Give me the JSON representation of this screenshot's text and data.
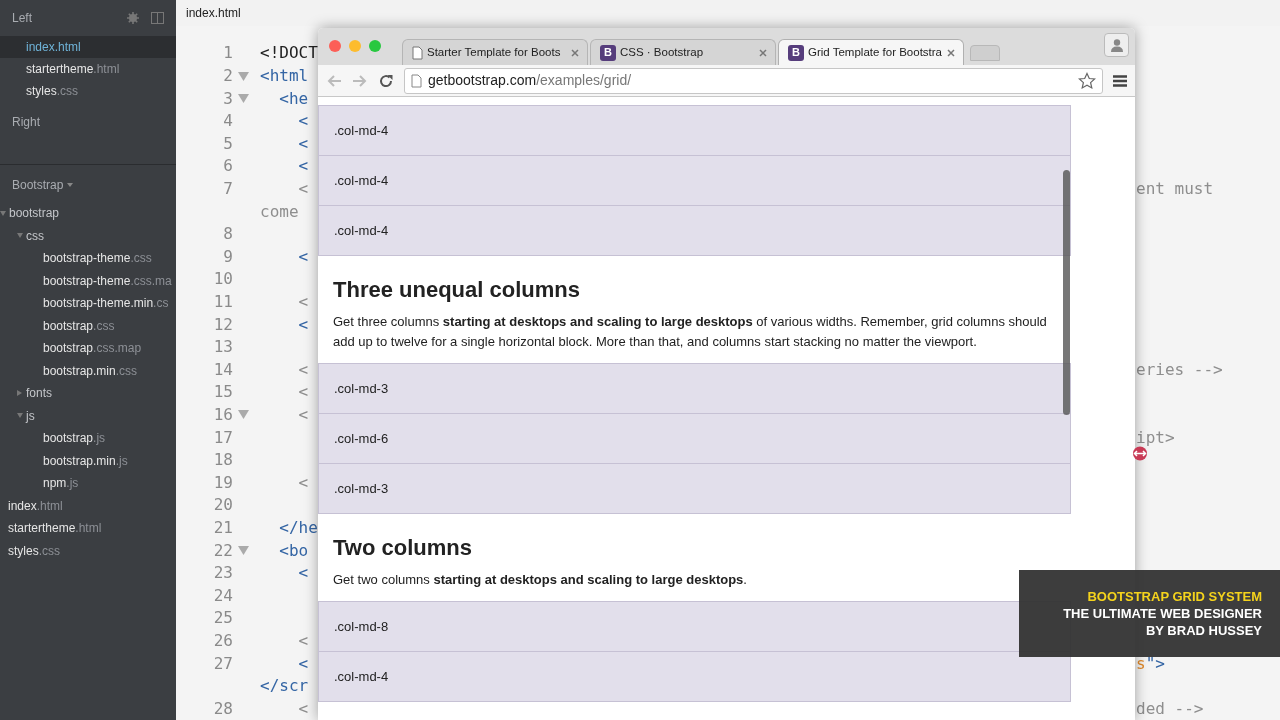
{
  "sidebar": {
    "working_files": {
      "title": "Left",
      "items": [
        {
          "name": "index",
          "ext": ".html",
          "selected": true
        },
        {
          "name": "startertheme",
          "ext": ".html",
          "selected": false
        },
        {
          "name": "styles",
          "ext": ".css",
          "selected": false
        }
      ]
    },
    "right_pane": {
      "title": "Right"
    },
    "project": {
      "title": "Bootstrap",
      "tree": [
        {
          "kind": "folder",
          "name": "bootstrap",
          "expanded": true,
          "children": [
            {
              "kind": "folder",
              "name": "css",
              "expanded": true,
              "children": [
                {
                  "kind": "file",
                  "name": "bootstrap-theme",
                  "ext": ".css"
                },
                {
                  "kind": "file",
                  "name": "bootstrap-theme",
                  "ext": ".css.ma"
                },
                {
                  "kind": "file",
                  "name": "bootstrap-theme.min",
                  "ext": ".cs"
                },
                {
                  "kind": "file",
                  "name": "bootstrap",
                  "ext": ".css"
                },
                {
                  "kind": "file",
                  "name": "bootstrap",
                  "ext": ".css.map"
                },
                {
                  "kind": "file",
                  "name": "bootstrap.min",
                  "ext": ".css"
                }
              ]
            },
            {
              "kind": "folder",
              "name": "fonts",
              "expanded": false
            },
            {
              "kind": "folder",
              "name": "js",
              "expanded": true,
              "children": [
                {
                  "kind": "file",
                  "name": "bootstrap",
                  "ext": ".js"
                },
                {
                  "kind": "file",
                  "name": "bootstrap.min",
                  "ext": ".js"
                },
                {
                  "kind": "file",
                  "name": "npm",
                  "ext": ".js"
                }
              ]
            }
          ]
        },
        {
          "kind": "file",
          "name": "index",
          "ext": ".html"
        },
        {
          "kind": "file",
          "name": "startertheme",
          "ext": ".html"
        },
        {
          "kind": "file",
          "name": "styles",
          "ext": ".css"
        }
      ]
    }
  },
  "editor": {
    "tab": "index.html",
    "lines": [
      {
        "number": "1",
        "fold": false,
        "left": {
          "text": "<!DOCT",
          "kind": "plain"
        }
      },
      {
        "number": "2",
        "fold": true,
        "left": {
          "text": "<html",
          "kind": "tag"
        }
      },
      {
        "number": "3",
        "fold": true,
        "left": {
          "text": "  <he",
          "kind": "tag"
        }
      },
      {
        "number": "4",
        "fold": false,
        "left": {
          "text": "    <",
          "kind": "tag"
        }
      },
      {
        "number": "5",
        "fold": false,
        "left": {
          "text": "    <",
          "kind": "tag"
        }
      },
      {
        "number": "6",
        "fold": false,
        "left": {
          "text": "    <",
          "kind": "tag"
        }
      },
      {
        "number": "7",
        "fold": false,
        "left": {
          "text": "    <",
          "kind": "comment"
        },
        "right": [
          {
            "text": "ent must",
            "kind": "comment"
          }
        ]
      },
      {
        "fold": false,
        "left": {
          "text": "come",
          "kind": "comment"
        }
      },
      {
        "number": "8",
        "fold": false
      },
      {
        "number": "9",
        "fold": false,
        "left": {
          "text": "    <",
          "kind": "tag"
        }
      },
      {
        "number": "10",
        "fold": false
      },
      {
        "number": "11",
        "fold": false,
        "left": {
          "text": "    <",
          "kind": "comment"
        }
      },
      {
        "number": "12",
        "fold": false,
        "left": {
          "text": "    <",
          "kind": "tag"
        }
      },
      {
        "number": "13",
        "fold": false
      },
      {
        "number": "14",
        "fold": false,
        "left": {
          "text": "    <",
          "kind": "comment"
        },
        "right": [
          {
            "text": "eries -->",
            "kind": "comment"
          }
        ]
      },
      {
        "number": "15",
        "fold": false,
        "left": {
          "text": "    <",
          "kind": "comment"
        }
      },
      {
        "number": "16",
        "fold": true,
        "left": {
          "text": "    <",
          "kind": "comment"
        }
      },
      {
        "number": "17",
        "fold": false,
        "right": [
          {
            "text": "ipt>",
            "kind": "comment"
          }
        ]
      },
      {
        "number": "18",
        "fold": false
      },
      {
        "number": "19",
        "fold": false,
        "left": {
          "text": "    <",
          "kind": "comment"
        }
      },
      {
        "number": "20",
        "fold": false
      },
      {
        "number": "21",
        "fold": false,
        "left": {
          "text": "  </he",
          "kind": "tag"
        }
      },
      {
        "number": "22",
        "fold": true,
        "left": {
          "text": "  <bo",
          "kind": "tag"
        }
      },
      {
        "number": "23",
        "fold": false,
        "left": {
          "text": "    <",
          "kind": "tag"
        }
      },
      {
        "number": "24",
        "fold": false
      },
      {
        "number": "25",
        "fold": false
      },
      {
        "number": "26",
        "fold": false,
        "left": {
          "text": "    <",
          "kind": "comment"
        }
      },
      {
        "number": "27",
        "fold": false,
        "left": {
          "text": "    <",
          "kind": "tag"
        },
        "right": [
          {
            "text": "s",
            "kind": "string"
          },
          {
            "text": "\">",
            "kind": "tag"
          }
        ]
      },
      {
        "fold": false,
        "left": {
          "text": "</scr",
          "kind": "tag"
        }
      },
      {
        "number": "28",
        "fold": false,
        "left": {
          "text": "    <",
          "kind": "comment"
        },
        "right": [
          {
            "text": "ded -->",
            "kind": "comment"
          }
        ]
      }
    ]
  },
  "browser": {
    "tabs": [
      {
        "title": "Starter Template for Boots",
        "selected": false
      },
      {
        "title": "CSS · Bootstrap",
        "favicon": "B",
        "selected": false
      },
      {
        "title": "Grid Template for Bootstra",
        "favicon": "B",
        "selected": true
      }
    ],
    "url": {
      "host": "getbootstrap.com",
      "path": "/examples/grid/"
    },
    "content": [
      {
        "kind": "column",
        "text": ".col-md-4"
      },
      {
        "kind": "column",
        "text": ".col-md-4"
      },
      {
        "kind": "column",
        "text": ".col-md-4"
      },
      {
        "kind": "heading",
        "text": "Three unequal columns"
      },
      {
        "kind": "paragraph",
        "text": "Get three columns **starting at desktops and scaling to large desktops** of various widths. Remember, grid columns should add up to twelve for a single horizontal block. More than that, and columns start stacking no matter the viewport."
      },
      {
        "kind": "column",
        "text": ".col-md-3"
      },
      {
        "kind": "column",
        "text": ".col-md-6"
      },
      {
        "kind": "column",
        "text": ".col-md-3"
      },
      {
        "kind": "heading",
        "text": "Two columns"
      },
      {
        "kind": "paragraph",
        "text": "Get two columns **starting at desktops and scaling to large desktops**."
      },
      {
        "kind": "column",
        "text": ".col-md-8"
      },
      {
        "kind": "column",
        "text": ".col-md-4"
      }
    ]
  },
  "overlay": {
    "lines": [
      {
        "text": "BOOTSTRAP GRID SYSTEM",
        "kind": "title"
      },
      {
        "text": "THE ULTIMATE WEB DESIGNER",
        "kind": "subtitle"
      },
      {
        "text": "BY BRAD HUSSEY",
        "kind": "subtitle"
      }
    ]
  }
}
